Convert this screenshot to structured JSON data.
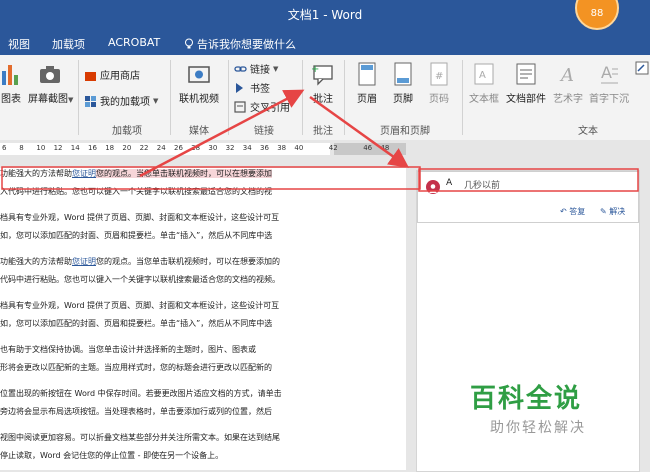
{
  "window": {
    "title": "文档1 - Word",
    "badge": "88"
  },
  "tabs": [
    {
      "label": "视图"
    },
    {
      "label": "加载项"
    },
    {
      "label": "ACROBAT"
    },
    {
      "label": "告诉我你想要做什么"
    }
  ],
  "ribbon": {
    "chart_label": "图表",
    "screenshot_label": "屏幕截图",
    "store_label": "应用商店",
    "my_addins_label": "我的加载项",
    "online_video_label": "联机视频",
    "link_label": "链接",
    "bookmark_label": "书签",
    "crossref_label": "交叉引用",
    "comment_label": "批注",
    "header_label": "页眉",
    "footer_label": "页脚",
    "page_number_label": "页码",
    "textbox_label": "文本框",
    "quickparts_label": "文档部件",
    "wordart_label": "艺术字",
    "dropcap_label": "首字下沉",
    "groups": {
      "addins": "加载项",
      "media": "媒体",
      "links": "链接",
      "comments": "批注",
      "header_footer": "页眉和页脚",
      "text": "文本"
    }
  },
  "ruler": [
    "6",
    "8",
    "10",
    "12",
    "14",
    "16",
    "18",
    "20",
    "22",
    "24",
    "26",
    "28",
    "30",
    "32",
    "34",
    "36",
    "38",
    "40",
    "",
    "42",
    "",
    "46",
    "48"
  ],
  "document": {
    "paragraphs": [
      [
        "功能强大的方法帮助",
        "您证明",
        "您的观点。当您单击联机视频时，可以在想要添加"
      ],
      [
        "入代码中进行粘贴。您也可以键入一个关键字以联机搜索最适合您的文档的视"
      ],
      [
        "档具有专业外观，Word 提供了页眉、页脚、封面和文本框设计，这些设计可互"
      ],
      [
        "如，您可以添加匹配的封面、页眉和提要栏。单击“插入”，然后从不同库中选"
      ],
      [
        "功能强大的方法帮助",
        "您证明",
        "您的观点。当您单击联机视频时，可以在想要添加的"
      ],
      [
        "代码中进行粘贴。您也可以键入一个关键字以联机搜索最适合您的文档的视频。"
      ],
      [
        "档具有专业外观，Word 提供了页眉、页脚、封面和文本框设计，这些设计可互"
      ],
      [
        "如，您可以添加匹配的封面、页眉和提要栏。单击“插入”，然后从不同库中选"
      ],
      [
        "也有助于文档保持协调。当您单击设计并选择新的主题时，图片、图表或"
      ],
      [
        "形将会更改以匹配新的主题。当应用",
        "样式时，您的标题会进行更改以匹配新的"
      ],
      [
        "位置出现的新按钮在 Word 中保存时间。若要更改图片适应文档的方式，请单击"
      ],
      [
        "旁边将会显示布局选项按钮。当处理表格时，单击要添加行或列的位置，然后"
      ],
      [
        "视图中阅读更加容易。可以折叠文档某些部分并关注所需文本。如果在达到结尾"
      ],
      [
        "停止读取，Word 会记住您的停止位置 - 即使在另一个设备上。"
      ]
    ]
  },
  "comment": {
    "author": "A",
    "time": "几秒以前",
    "reply": "答复",
    "resolve": "解决"
  },
  "watermark": {
    "title": "百科全说",
    "subtitle": "助你轻松解决"
  },
  "colors": {
    "accent": "#2b579a",
    "arrow": "#e64545",
    "watermark": "#2f9e44"
  }
}
